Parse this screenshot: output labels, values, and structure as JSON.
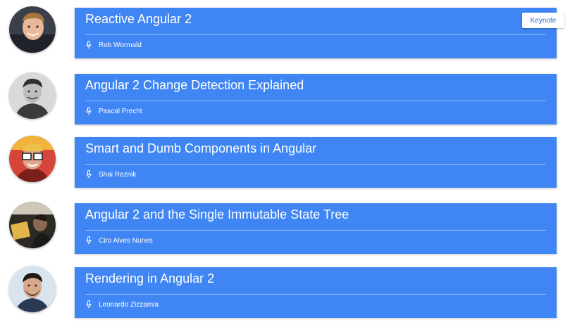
{
  "talks": [
    {
      "title": "Reactive Angular 2",
      "speaker": "Rob Wormald",
      "badge": "Keynote",
      "avatar_icon": "speaker-avatar-rob-wormald"
    },
    {
      "title": "Angular 2 Change Detection Explained",
      "speaker": "Pascal Precht",
      "avatar_icon": "speaker-avatar-pascal-precht"
    },
    {
      "title": "Smart and Dumb Components in Angular",
      "speaker": "Shai Reznik",
      "avatar_icon": "speaker-avatar-shai-reznik"
    },
    {
      "title": "Angular 2 and the Single Immutable State Tree",
      "speaker": "Ciro Alves Nunes",
      "avatar_icon": "speaker-avatar-ciro-alves-nunes"
    },
    {
      "title": "Rendering in Angular 2",
      "speaker": "Leonardo Zizzamia",
      "avatar_icon": "speaker-avatar-leonardo-zizzamia"
    }
  ],
  "icons": {
    "speaker": "microphone-icon"
  },
  "colors": {
    "card": "#3f85f4",
    "card_text": "#ffffff",
    "badge_text": "#2a6fd6"
  }
}
